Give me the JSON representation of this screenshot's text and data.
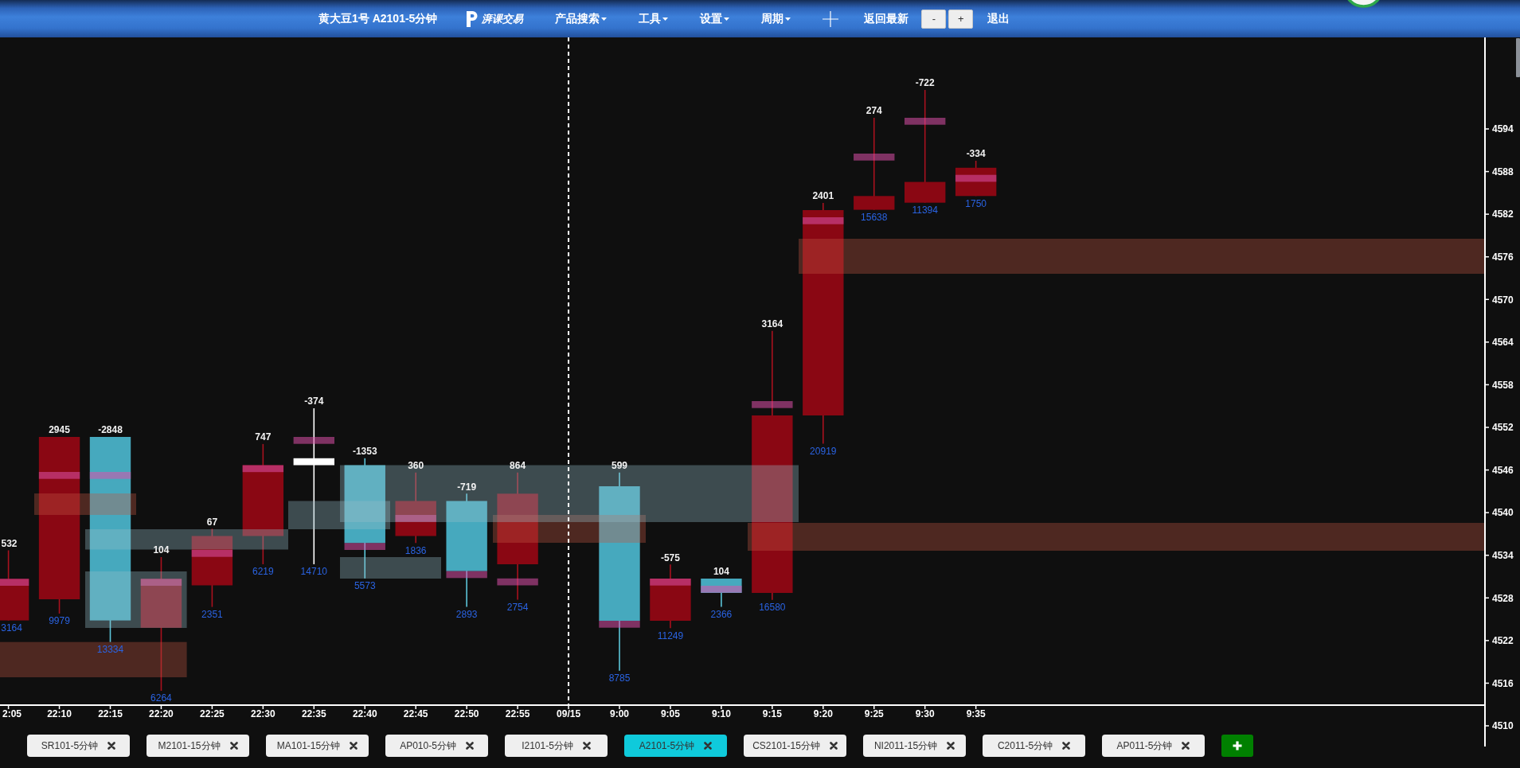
{
  "toolbar": {
    "title": "黄大豆1号 A2101-5分钟",
    "logo_text": "湃课交易",
    "menus": [
      {
        "label": "产品搜索"
      },
      {
        "label": "工具"
      },
      {
        "label": "设置"
      },
      {
        "label": "周期"
      }
    ],
    "latest_button": "返回最新",
    "zoom_buttons": [
      "-",
      "+"
    ],
    "exit_button": "退出"
  },
  "chart": {
    "candles": [
      {
        "kind": "up",
        "label_above": "532",
        "label_below": "3164"
      },
      {
        "kind": "up",
        "label_above": "2945",
        "label_below": "9979"
      },
      {
        "kind": "down",
        "label_above": "-2848",
        "label_below": "13334"
      },
      {
        "kind": "up",
        "label_above": "104",
        "label_below": "6264"
      },
      {
        "kind": "up",
        "label_above": "67",
        "label_below": "2351"
      },
      {
        "kind": "up",
        "label_above": "747",
        "label_below": "6219"
      },
      {
        "kind": "doji",
        "label_above": "-374",
        "label_below": "14710"
      },
      {
        "kind": "down",
        "label_above": "-1353",
        "label_below": "5573"
      },
      {
        "kind": "up",
        "label_above": "360",
        "label_below": "1836"
      },
      {
        "kind": "down",
        "label_above": "-719",
        "label_below": "2893"
      },
      {
        "kind": "up",
        "label_above": "864",
        "label_below": "2754"
      },
      {
        "kind": "down",
        "label_above": "599",
        "label_below": "8785"
      },
      {
        "kind": "up",
        "label_above": "-575",
        "label_below": "11249"
      },
      {
        "kind": "down",
        "label_above": "104",
        "label_below": "2366"
      },
      {
        "kind": "up",
        "label_above": "3164",
        "label_below": "16580"
      },
      {
        "kind": "up",
        "label_above": "2401",
        "label_below": "20919"
      },
      {
        "kind": "up",
        "label_above": "274",
        "label_below": "15638"
      },
      {
        "kind": "up",
        "label_above": "-722",
        "label_below": "11394"
      },
      {
        "kind": "up",
        "label_above": "-334",
        "label_below": "1750"
      }
    ],
    "x_axis_labels": [
      "2:05",
      "22:10",
      "22:15",
      "22:20",
      "22:25",
      "22:30",
      "22:35",
      "22:40",
      "22:45",
      "22:50",
      "22:55",
      "09/15",
      "9:00",
      "9:05",
      "9:10",
      "9:15",
      "9:20",
      "9:25",
      "9:30",
      "9:35"
    ],
    "y_axis_labels": [
      "4594",
      "4588",
      "4582",
      "4576",
      "4570",
      "4564",
      "4558",
      "4552",
      "4546",
      "4540",
      "4534",
      "4528",
      "4522",
      "4516",
      "4510"
    ]
  },
  "tabs": [
    {
      "label": "SR101-5分钟",
      "selected": false
    },
    {
      "label": "M2101-15分钟",
      "selected": false
    },
    {
      "label": "MA101-15分钟",
      "selected": false
    },
    {
      "label": "AP010-5分钟",
      "selected": false
    },
    {
      "label": "I2101-5分钟",
      "selected": false
    },
    {
      "label": "A2101-5分钟",
      "selected": true
    },
    {
      "label": "CS2101-15分钟",
      "selected": false
    },
    {
      "label": "NI2011-15分钟",
      "selected": false
    },
    {
      "label": "C2011-5分钟",
      "selected": false
    },
    {
      "label": "AP011-5分钟",
      "selected": false
    }
  ]
}
